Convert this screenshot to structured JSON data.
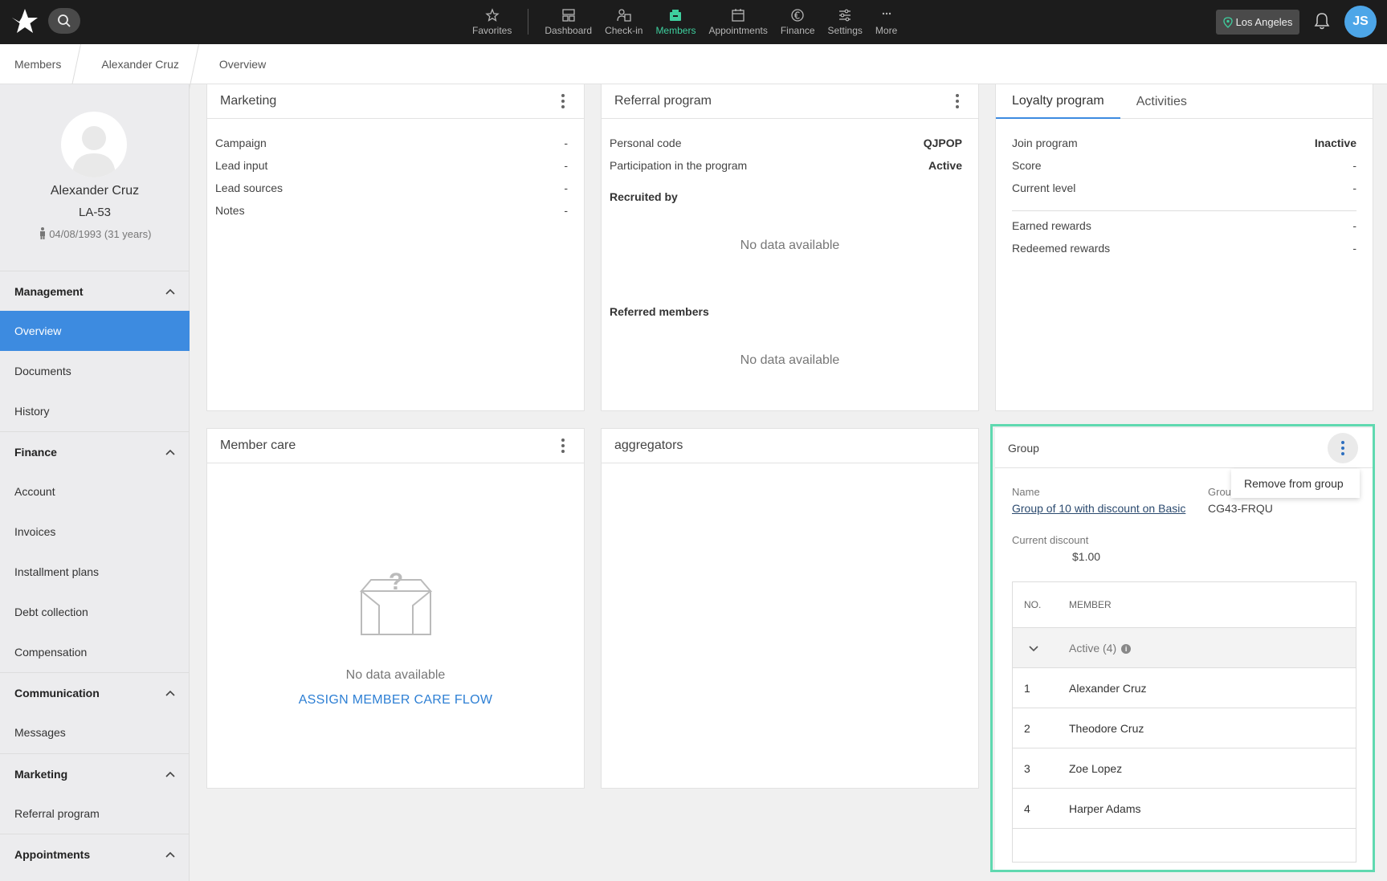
{
  "topbar": {
    "nav": [
      {
        "label": "Favorites",
        "icon": "star-icon"
      },
      {
        "label": "Dashboard",
        "icon": "dashboard-icon"
      },
      {
        "label": "Check-in",
        "icon": "check-in-icon"
      },
      {
        "label": "Members",
        "icon": "members-icon",
        "active": true
      },
      {
        "label": "Appointments",
        "icon": "calendar-icon"
      },
      {
        "label": "Finance",
        "icon": "euro-icon"
      },
      {
        "label": "Settings",
        "icon": "sliders-icon"
      },
      {
        "label": "More",
        "icon": "more-icon"
      }
    ],
    "location": "Los Angeles",
    "user_initials": "JS",
    "accent": "#3ecf9e"
  },
  "breadcrumb": [
    "Members",
    "Alexander Cruz",
    "Overview"
  ],
  "profile": {
    "name": "Alexander Cruz",
    "id": "LA-53",
    "dob": "04/08/1993 (31 years)"
  },
  "sidebar": {
    "management": "Management",
    "overview": "Overview",
    "documents": "Documents",
    "history": "History",
    "finance": "Finance",
    "account": "Account",
    "invoices": "Invoices",
    "installment_plans": "Installment plans",
    "debt_collection": "Debt collection",
    "compensation": "Compensation",
    "communication": "Communication",
    "messages": "Messages",
    "marketing": "Marketing",
    "referral_program": "Referral program",
    "appointments": "Appointments"
  },
  "marketing": {
    "title": "Marketing",
    "rows": [
      {
        "label": "Campaign",
        "value": "-"
      },
      {
        "label": "Lead input",
        "value": "-"
      },
      {
        "label": "Lead sources",
        "value": "-"
      },
      {
        "label": "Notes",
        "value": "-"
      }
    ]
  },
  "referral": {
    "title": "Referral program",
    "personal_code_label": "Personal code",
    "personal_code": "QJPOP",
    "participation_label": "Participation in the program",
    "participation": "Active",
    "recruited_by": "Recruited by",
    "referred_members": "Referred members",
    "no_data": "No data available"
  },
  "loyalty": {
    "tab_loyalty": "Loyalty program",
    "tab_activities": "Activities",
    "rows": [
      {
        "label": "Join program",
        "value": "Inactive"
      },
      {
        "label": "Score",
        "value": "-"
      },
      {
        "label": "Current level",
        "value": "-"
      },
      {
        "label": "Earned rewards",
        "value": "-"
      },
      {
        "label": "Redeemed rewards",
        "value": "-"
      }
    ]
  },
  "member_care": {
    "title": "Member care",
    "no_data": "No data available",
    "assign": "ASSIGN MEMBER CARE FLOW"
  },
  "aggregators": {
    "title": "aggregators"
  },
  "group": {
    "title": "Group",
    "menu_item": "Remove from group",
    "name_label": "Name",
    "name_value": "Group of 10 with discount on Basic",
    "code_label": "Grou",
    "code_value": "CG43-FRQU",
    "discount_label": "Current discount",
    "discount_value": "$1.00",
    "col_no": "NO.",
    "col_member": "MEMBER",
    "active_group": "Active (4)",
    "members": [
      {
        "no": "1",
        "name": "Alexander Cruz"
      },
      {
        "no": "2",
        "name": "Theodore Cruz"
      },
      {
        "no": "3",
        "name": "Zoe Lopez"
      },
      {
        "no": "4",
        "name": "Harper Adams"
      }
    ]
  }
}
